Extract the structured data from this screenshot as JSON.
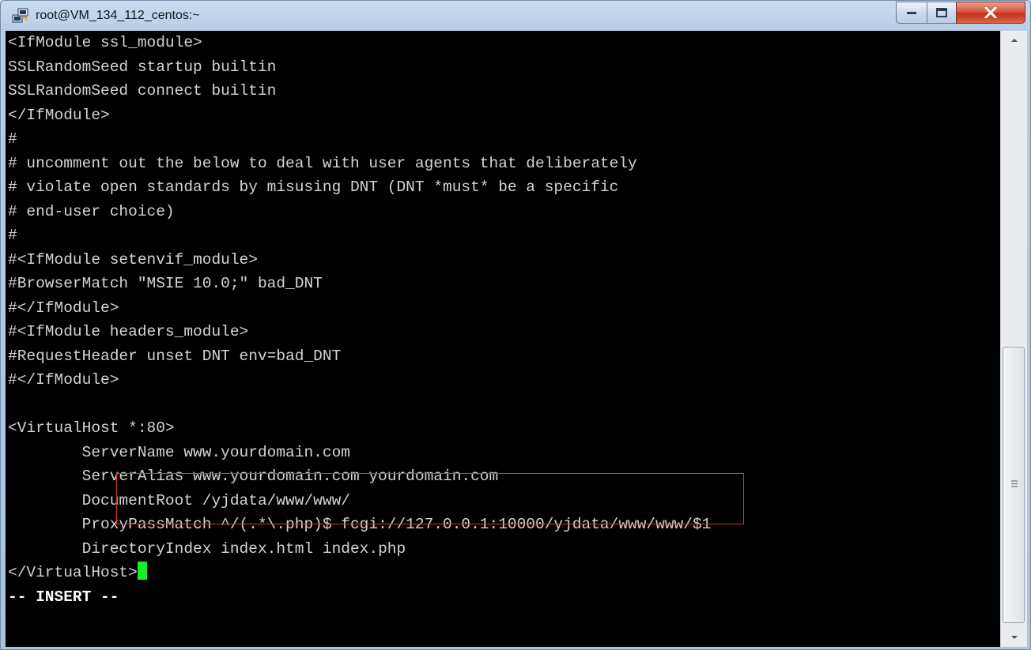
{
  "window": {
    "title": "root@VM_134_112_centos:~"
  },
  "terminal": {
    "lines": [
      "<IfModule ssl_module>",
      "SSLRandomSeed startup builtin",
      "SSLRandomSeed connect builtin",
      "</IfModule>",
      "#",
      "# uncomment out the below to deal with user agents that deliberately",
      "# violate open standards by misusing DNT (DNT *must* be a specific",
      "# end-user choice)",
      "#",
      "#<IfModule setenvif_module>",
      "#BrowserMatch \"MSIE 10.0;\" bad_DNT",
      "#</IfModule>",
      "#<IfModule headers_module>",
      "#RequestHeader unset DNT env=bad_DNT",
      "#</IfModule>",
      "",
      "<VirtualHost *:80>",
      "        ServerName www.yourdomain.com",
      "        ServerAlias www.yourdomain.com yourdomain.com",
      "        DocumentRoot /yjdata/www/www/",
      "        ProxyPassMatch ^/(.*\\.php)$ fcgi://127.0.0.1:10000/yjdata/www/www/$1",
      "        DirectoryIndex index.html index.php",
      "</VirtualHost>"
    ],
    "status_line": "-- INSERT --"
  },
  "colors": {
    "terminal_background": "#000000",
    "terminal_text": "#d4d4d4",
    "cursor": "#17ee2a",
    "highlight_box": "#d8322e"
  },
  "icons": {
    "app": "putty-icon",
    "minimize": "minimize-icon",
    "maximize": "maximize-icon",
    "close": "close-icon",
    "scroll_up": "scroll-up-arrow-icon",
    "scroll_down": "scroll-down-arrow-icon"
  }
}
